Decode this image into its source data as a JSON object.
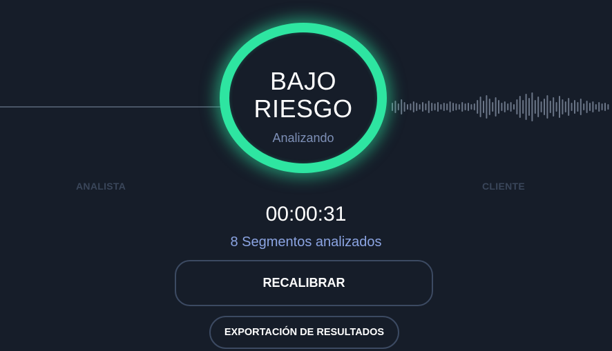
{
  "status": {
    "risk_label_line1": "BAJO",
    "risk_label_line2": "RIESGO",
    "state": "Analizando"
  },
  "speakers": {
    "left": "ANALISTA",
    "right": "CLIENTE"
  },
  "timer": "00:00:31",
  "segments_text": "8 Segmentos analizados",
  "buttons": {
    "recalibrate": "RECALIBRAR",
    "export": "EXPORTACIÓN DE RESULTADOS"
  },
  "colors": {
    "background": "#161d29",
    "ring_accent": "#2ee5a1",
    "segments_text": "#8ba4e2",
    "status_sub": "#7d8fb6",
    "button_border": "#3c4a62"
  },
  "icons": {
    "left_channel": "flat-line-waveform",
    "right_channel": "audio-waveform"
  }
}
